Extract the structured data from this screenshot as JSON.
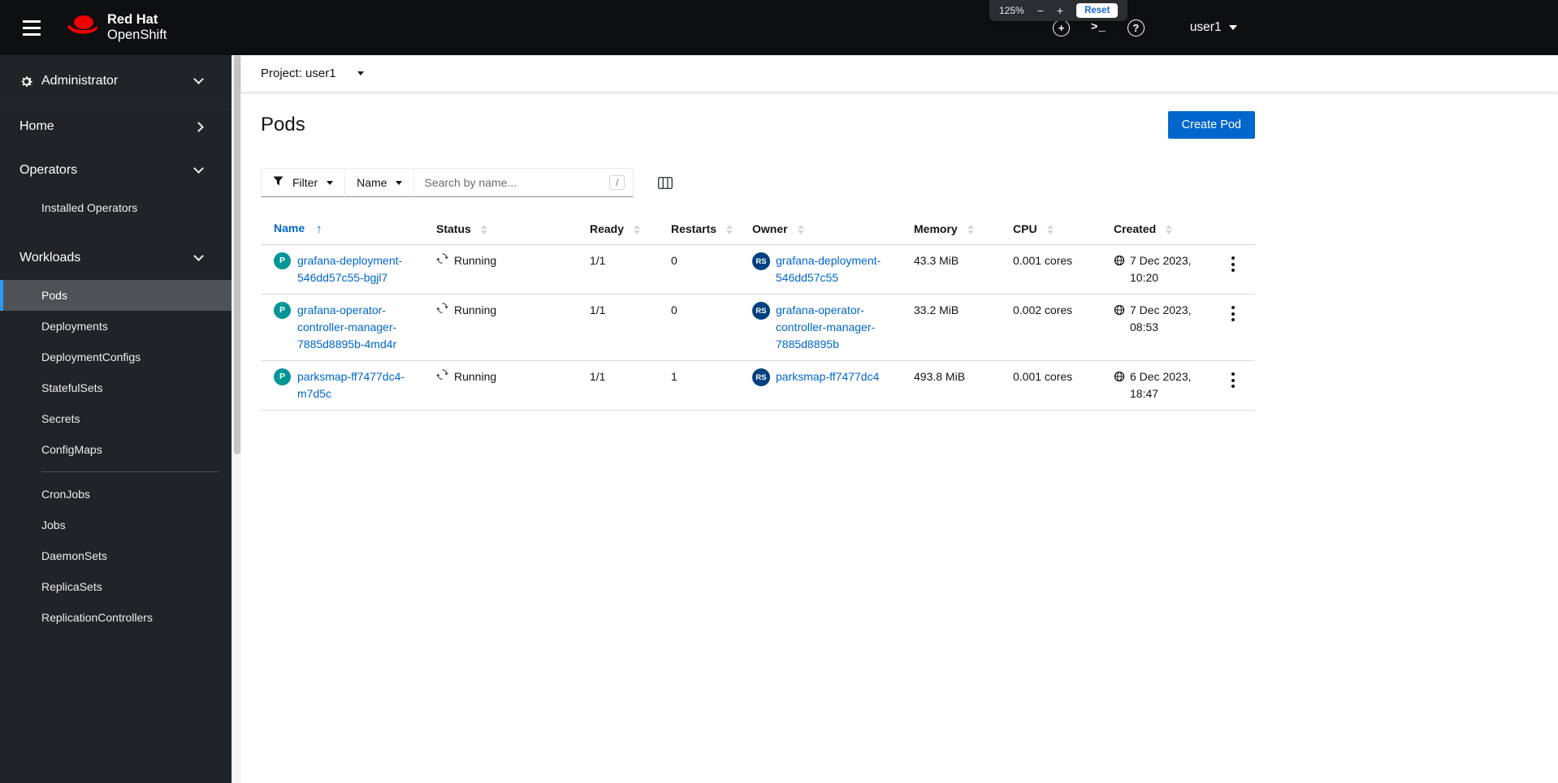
{
  "colors": {
    "accent_blue": "#0066cc",
    "link_blue": "#0066cc",
    "masthead_bg": "#0d0f11",
    "sidebar_bg": "#212427",
    "nav_selected_bg": "#4f5255",
    "nav_selected_border": "#2b9af3",
    "pod_badge_bg": "#009596",
    "replicaset_badge_bg": "#004080",
    "redhat_red": "#ee0000"
  },
  "masthead": {
    "brand_line1": "Red Hat",
    "brand_line2": "OpenShift",
    "user": "user1",
    "icon_glyphs": {
      "plus": "+",
      "terminal": ">_",
      "help": "?"
    },
    "zoom_popup": {
      "level": "125%",
      "minus": "−",
      "plus": "+",
      "reset": "Reset"
    }
  },
  "sidebar": {
    "perspective": "Administrator",
    "home": "Home",
    "operators": "Operators",
    "installed_operators": "Installed Operators",
    "workloads": "Workloads",
    "workload_items": [
      "Pods",
      "Deployments",
      "DeploymentConfigs",
      "StatefulSets",
      "Secrets",
      "ConfigMaps",
      "CronJobs",
      "Jobs",
      "DaemonSets",
      "ReplicaSets",
      "ReplicationControllers"
    ],
    "selected_item": "Pods"
  },
  "project_bar": {
    "label": "Project:",
    "value": "user1"
  },
  "page": {
    "title": "Pods",
    "create_button": "Create Pod"
  },
  "toolbar": {
    "filter_label": "Filter",
    "attribute_label": "Name",
    "search_placeholder": "Search by name...",
    "shortcut_hint": "/"
  },
  "table": {
    "sort_arrow": "↑",
    "sorted_by": "Name",
    "columns": [
      {
        "label": "Name",
        "sorted": "ascending"
      },
      {
        "label": "Status"
      },
      {
        "label": "Ready"
      },
      {
        "label": "Restarts"
      },
      {
        "label": "Owner"
      },
      {
        "label": "Memory"
      },
      {
        "label": "CPU"
      },
      {
        "label": "Created"
      }
    ],
    "rows": [
      {
        "badge": "P",
        "name": "grafana-deployment-546dd57c55-bgjl7",
        "status": "Running",
        "ready": "1/1",
        "restarts": "0",
        "owner_badge": "RS",
        "owner": "grafana-deployment-546dd57c55",
        "memory": "43.3 MiB",
        "cpu": "0.001 cores",
        "created": "7 Dec 2023, 10:20"
      },
      {
        "badge": "P",
        "name": "grafana-operator-controller-manager-7885d8895b-4md4r",
        "status": "Running",
        "ready": "1/1",
        "restarts": "0",
        "owner_badge": "RS",
        "owner": "grafana-operator-controller-manager-7885d8895b",
        "memory": "33.2 MiB",
        "cpu": "0.002 cores",
        "created": "7 Dec 2023, 08:53"
      },
      {
        "badge": "P",
        "name": "parksmap-ff7477dc4-m7d5c",
        "status": "Running",
        "ready": "1/1",
        "restarts": "1",
        "owner_badge": "RS",
        "owner": "parksmap-ff7477dc4",
        "memory": "493.8 MiB",
        "cpu": "0.001 cores",
        "created": "6 Dec 2023, 18:47"
      }
    ]
  }
}
